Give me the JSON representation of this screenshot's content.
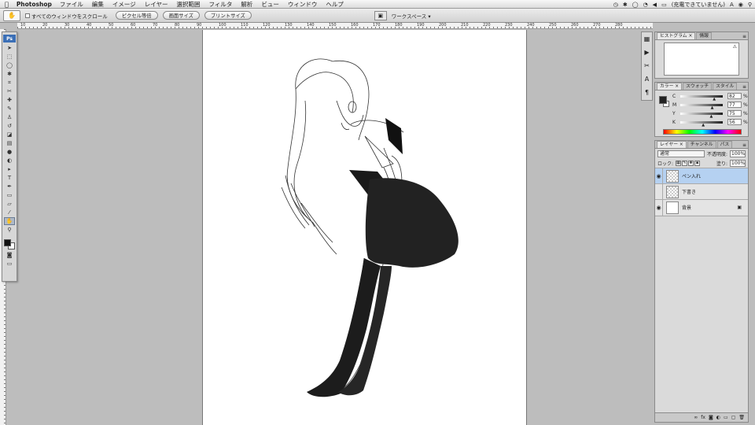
{
  "menubar": {
    "apple": "",
    "app_name": "Photoshop",
    "items": [
      "ファイル",
      "編集",
      "イメージ",
      "レイヤー",
      "選択範囲",
      "フィルタ",
      "解析",
      "ビュー",
      "ウィンドウ",
      "ヘルプ"
    ],
    "status_battery": "(充電できていません)",
    "status_lang": "A"
  },
  "options_bar": {
    "scroll_all_windows": "すべてのウィンドウをスクロール",
    "actual_pixels": "ピクセル等倍",
    "fit_screen": "画面サイズ",
    "print_size": "プリントサイズ",
    "workspace": "ワークスペース ▾"
  },
  "ruler_top_labels": [
    "10",
    "20",
    "30",
    "40",
    "50",
    "60",
    "70",
    "80",
    "90",
    "100",
    "110",
    "120",
    "130",
    "140",
    "150",
    "160",
    "170",
    "180",
    "190",
    "200",
    "210",
    "220",
    "230",
    "240",
    "250",
    "260",
    "270",
    "280"
  ],
  "toolbox": {
    "badge": "Ps",
    "tools": [
      {
        "name": "move-tool",
        "glyph": "➤"
      },
      {
        "name": "marquee-tool",
        "glyph": "⬚"
      },
      {
        "name": "lasso-tool",
        "glyph": "◯"
      },
      {
        "name": "magic-wand-tool",
        "glyph": "✱"
      },
      {
        "name": "crop-tool",
        "glyph": "⌗"
      },
      {
        "name": "slice-tool",
        "glyph": "✂"
      },
      {
        "name": "healing-brush-tool",
        "glyph": "✚"
      },
      {
        "name": "brush-tool",
        "glyph": "✎"
      },
      {
        "name": "clone-stamp-tool",
        "glyph": "♙"
      },
      {
        "name": "history-brush-tool",
        "glyph": "↺"
      },
      {
        "name": "eraser-tool",
        "glyph": "◪"
      },
      {
        "name": "gradient-tool",
        "glyph": "▤"
      },
      {
        "name": "blur-tool",
        "glyph": "●"
      },
      {
        "name": "dodge-tool",
        "glyph": "◐"
      },
      {
        "name": "path-selection-tool",
        "glyph": "▸"
      },
      {
        "name": "type-tool",
        "glyph": "T"
      },
      {
        "name": "pen-tool",
        "glyph": "✒"
      },
      {
        "name": "shape-tool",
        "glyph": "▭"
      },
      {
        "name": "notes-tool",
        "glyph": "▱"
      },
      {
        "name": "eyedropper-tool",
        "glyph": "⁄"
      },
      {
        "name": "hand-tool",
        "glyph": "✋"
      },
      {
        "name": "zoom-tool",
        "glyph": "⚲"
      }
    ]
  },
  "panels": {
    "histogram": {
      "tabs": [
        "ヒストグラム ×",
        "情報"
      ]
    },
    "color": {
      "tabs": [
        "カラー ×",
        "スウォッチ",
        "スタイル"
      ],
      "channels": [
        {
          "label": "C",
          "value": "82",
          "pct": 0.82
        },
        {
          "label": "M",
          "value": "77",
          "pct": 0.77
        },
        {
          "label": "Y",
          "value": "75",
          "pct": 0.75
        },
        {
          "label": "K",
          "value": "56",
          "pct": 0.56
        }
      ],
      "percent": "%"
    },
    "layers": {
      "tabs": [
        "レイヤー ×",
        "チャンネル",
        "パス"
      ],
      "blend_mode": "通常",
      "opacity_label": "不透明度:",
      "opacity": "100%",
      "lock_label": "ロック:",
      "fill_label": "塗り:",
      "fill": "100%",
      "items": [
        {
          "name": "ペン入れ",
          "selected": true
        },
        {
          "name": "下書き",
          "selected": false
        },
        {
          "name": "背景",
          "selected": false
        }
      ]
    }
  },
  "colors": {
    "accent_selected_layer": "#b5d1f1",
    "canvas": "#ffffff",
    "pasteboard": "#bdbdbd"
  }
}
